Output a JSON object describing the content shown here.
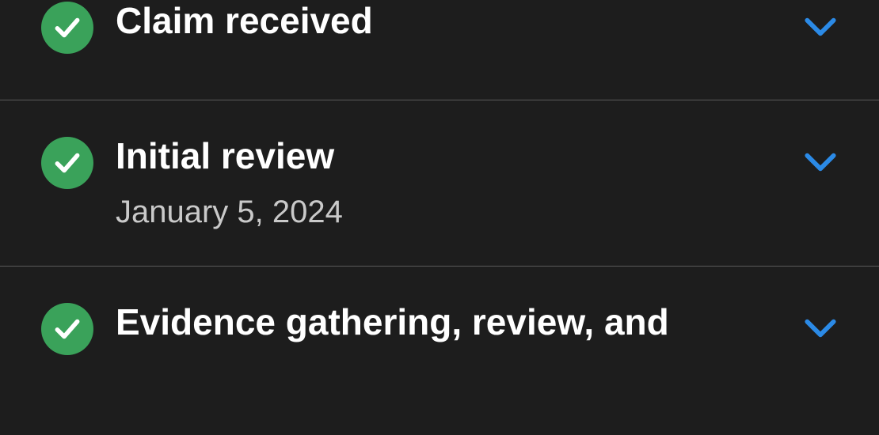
{
  "steps": [
    {
      "title": "Claim received",
      "subtitle": null
    },
    {
      "title": "Initial review",
      "subtitle": "January 5, 2024"
    },
    {
      "title": "Evidence gathering, review, and",
      "subtitle": null
    }
  ],
  "icons": {
    "status": "check-icon",
    "toggle": "chevron-down-icon"
  },
  "colors": {
    "bg": "#1d1d1d",
    "accent_green": "#3aa25a",
    "chevron_blue": "#2b8ae6",
    "divider": "#5a5a5a",
    "title_text": "#ffffff",
    "subtitle_text": "#c9c9c9"
  }
}
